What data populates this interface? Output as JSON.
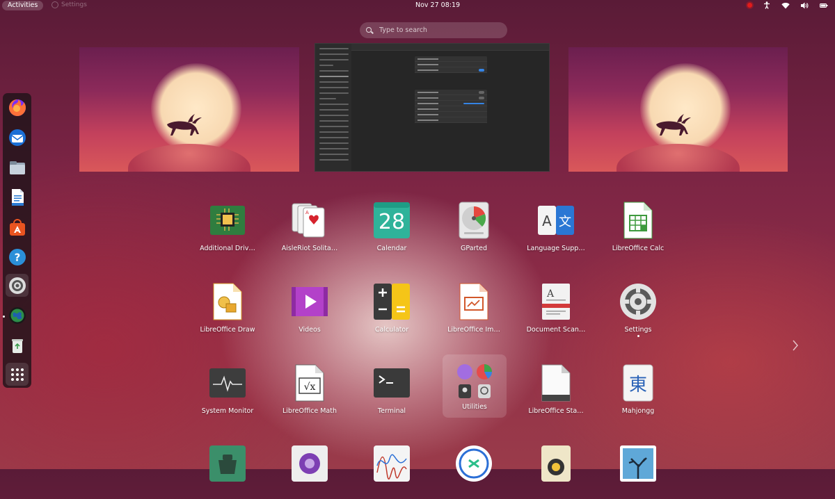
{
  "topbar": {
    "activities_label": "Activities",
    "app_label": "Settings",
    "clock": "Nov 27  08:19"
  },
  "search": {
    "placeholder": "Type to search"
  },
  "dock": {
    "items": [
      {
        "name": "Firefox",
        "icon": "firefox-icon"
      },
      {
        "name": "Thunderbird",
        "icon": "thunderbird-icon"
      },
      {
        "name": "Files",
        "icon": "files-icon"
      },
      {
        "name": "LibreOffice Writer",
        "icon": "writer-icon"
      },
      {
        "name": "Ubuntu Software",
        "icon": "software-icon"
      },
      {
        "name": "Help",
        "icon": "help-icon"
      },
      {
        "name": "Settings",
        "icon": "settings-icon"
      },
      {
        "name": "Web Browser",
        "icon": "globe-icon"
      },
      {
        "name": "Trash",
        "icon": "trash-icon"
      },
      {
        "name": "Show Applications",
        "icon": "app-grid-icon"
      }
    ]
  },
  "apps": {
    "row1": [
      "Additional Driv…",
      "AisleRiot Solita…",
      "Calendar",
      "GParted",
      "Language Supp…",
      "LibreOffice Calc"
    ],
    "row2": [
      "LibreOffice Draw",
      "Videos",
      "Calculator",
      "LibreOffice Im…",
      "Document Scan…",
      "Settings"
    ],
    "row3": [
      "System Monitor",
      "LibreOffice Math",
      "Terminal",
      "Utilities",
      "LibreOffice Sta…",
      "Mahjongg"
    ],
    "calendar_day": "28",
    "mahjongg_glyph": "東"
  },
  "colors": {
    "accent": "#e95420",
    "toggle_on": "#3584e4",
    "record_red": "#e21b1b"
  }
}
